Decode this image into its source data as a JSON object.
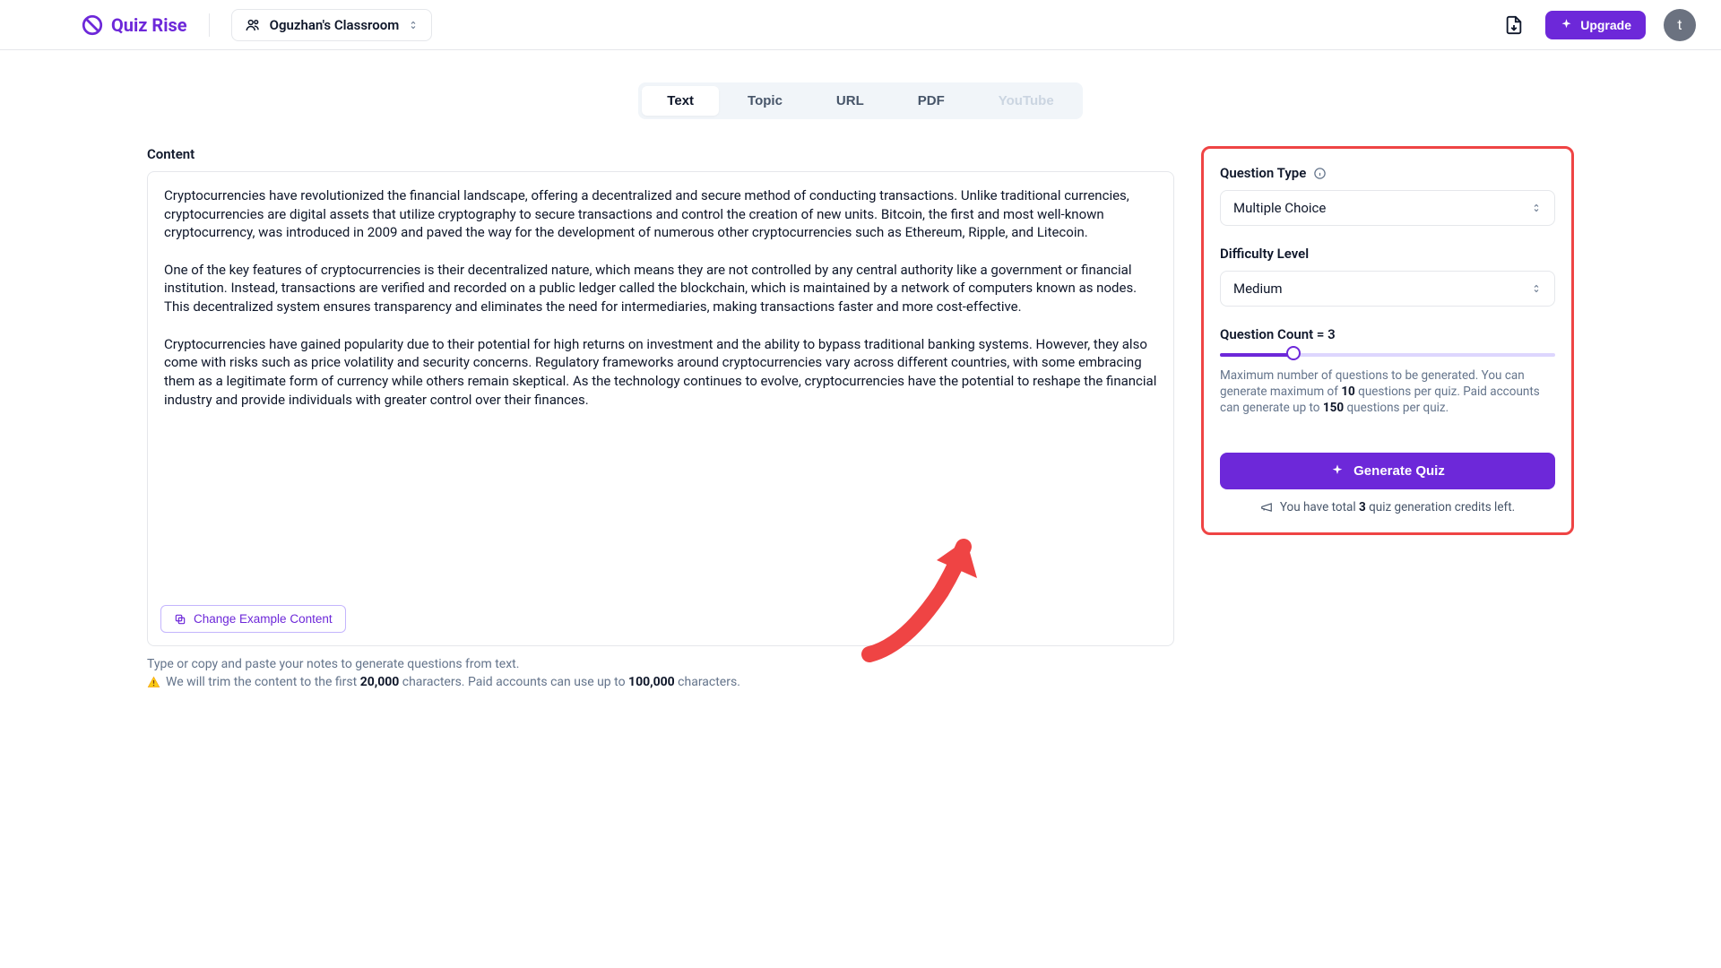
{
  "header": {
    "brand": "Quiz Rise",
    "classroom_label": "Oguzhan's Classroom",
    "upgrade_label": "Upgrade",
    "avatar_initial": "t"
  },
  "tabs": {
    "items": [
      {
        "label": "Text",
        "active": true
      },
      {
        "label": "Topic"
      },
      {
        "label": "URL"
      },
      {
        "label": "PDF"
      },
      {
        "label": "YouTube",
        "disabled": true
      }
    ]
  },
  "content": {
    "label": "Content",
    "text": "Cryptocurrencies have revolutionized the financial landscape, offering a decentralized and secure method of conducting transactions. Unlike traditional currencies, cryptocurrencies are digital assets that utilize cryptography to secure transactions and control the creation of new units. Bitcoin, the first and most well-known cryptocurrency, was introduced in 2009 and paved the way for the development of numerous other cryptocurrencies such as Ethereum, Ripple, and Litecoin.\n\nOne of the key features of cryptocurrencies is their decentralized nature, which means they are not controlled by any central authority like a government or financial institution. Instead, transactions are verified and recorded on a public ledger called the blockchain, which is maintained by a network of computers known as nodes. This decentralized system ensures transparency and eliminates the need for intermediaries, making transactions faster and more cost-effective.\n\nCryptocurrencies have gained popularity due to their potential for high returns on investment and the ability to bypass traditional banking systems. However, they also come with risks such as price volatility and security concerns. Regulatory frameworks around cryptocurrencies vary across different countries, with some embracing them as a legitimate form of currency while others remain skeptical. As the technology continues to evolve, cryptocurrencies have the potential to reshape the financial industry and provide individuals with greater control over their finances.",
    "change_button": "Change Example Content",
    "hint1": "Type or copy and paste your notes to generate questions from text.",
    "hint2_pre": "We will trim the content to the first ",
    "hint2_b1": "20,000",
    "hint2_mid": " characters. Paid accounts can use up to ",
    "hint2_b2": "100,000",
    "hint2_post": " characters."
  },
  "settings": {
    "qtype_label": "Question Type",
    "qtype_value": "Multiple Choice",
    "difficulty_label": "Difficulty Level",
    "difficulty_value": "Medium",
    "count_label": "Question Count = 3",
    "count_desc_a": "Maximum number of questions to be generated. You can generate maximum of ",
    "count_desc_b1": "10",
    "count_desc_b": " questions per quiz. Paid accounts can generate up to ",
    "count_desc_b2": "150",
    "count_desc_c": " questions per quiz.",
    "generate_label": "Generate Quiz",
    "credits_pre": "You have total ",
    "credits_num": "3",
    "credits_post": " quiz generation credits left."
  }
}
